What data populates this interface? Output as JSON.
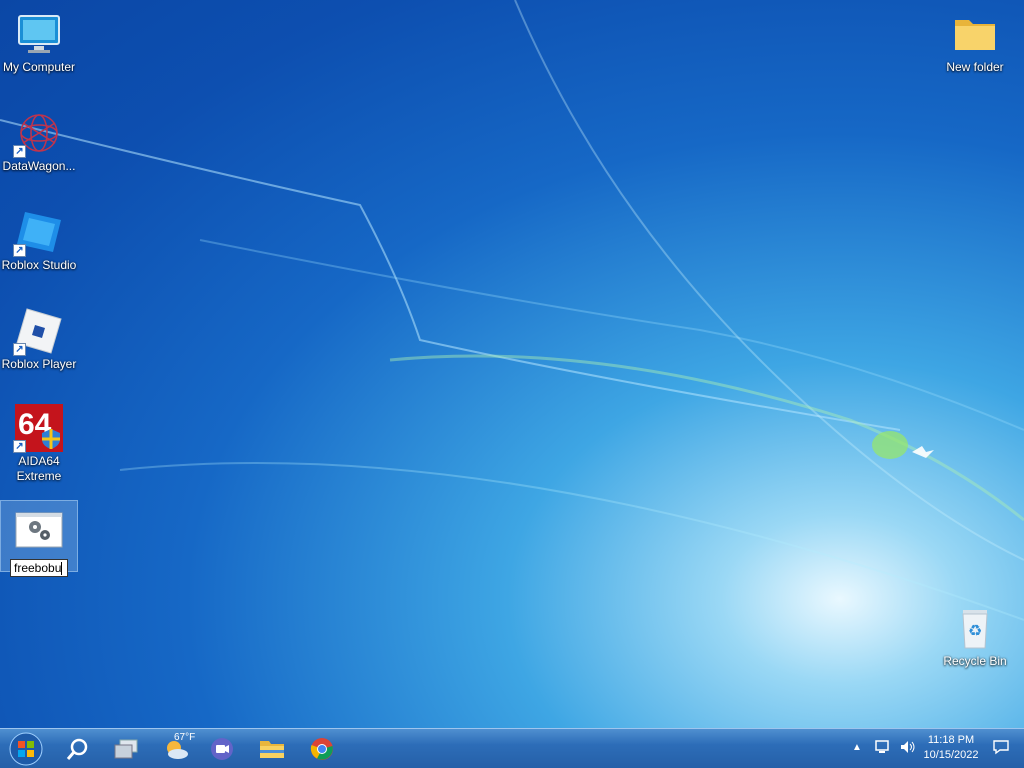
{
  "desktop": {
    "icons_left": [
      {
        "label": "My Computer",
        "icon": "monitor-icon"
      },
      {
        "label": "DataWagon...",
        "icon": "datawagon-icon",
        "shortcut": true
      },
      {
        "label": "Roblox Studio",
        "icon": "roblox-studio-icon",
        "shortcut": true
      },
      {
        "label": "Roblox Player",
        "icon": "roblox-player-icon",
        "shortcut": true
      },
      {
        "label": "AIDA64 Extreme",
        "icon": "aida64-icon",
        "shortcut": true,
        "badge_text": "64"
      },
      {
        "label": "freebobu",
        "icon": "settings-file-icon",
        "renaming": true
      }
    ],
    "new_folder": {
      "label": "New folder",
      "icon": "folder-icon"
    },
    "recycle_bin": {
      "label": "Recycle Bin",
      "icon": "recycle-bin-icon"
    }
  },
  "taskbar": {
    "start": {
      "icon": "windows-start-icon"
    },
    "pinned": [
      {
        "name": "search",
        "icon": "search-icon"
      },
      {
        "name": "task-view",
        "icon": "task-view-icon"
      },
      {
        "name": "weather",
        "icon": "weather-icon",
        "text": "67°F"
      },
      {
        "name": "meet",
        "icon": "video-call-icon"
      },
      {
        "name": "file-explorer",
        "icon": "file-explorer-icon"
      },
      {
        "name": "chrome",
        "icon": "chrome-icon"
      }
    ],
    "tray": {
      "time": "11:18 PM",
      "date": "10/15/2022",
      "icons": [
        "chevron-up-icon",
        "network-icon",
        "volume-icon",
        "notification-icon"
      ]
    }
  },
  "colors": {
    "taskbar": "#2d6db8",
    "desktop_accent": "#1668c6"
  }
}
